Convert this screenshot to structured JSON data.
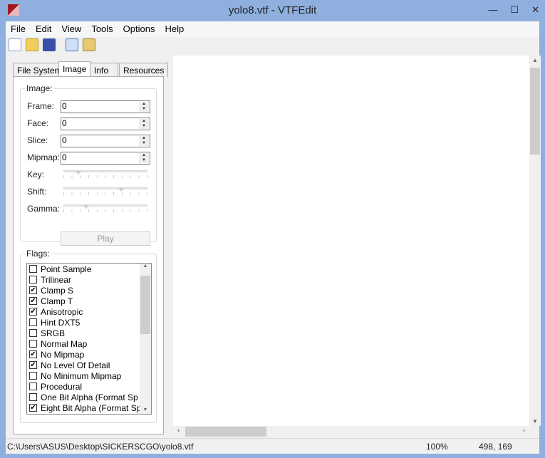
{
  "window": {
    "title": "yolo8.vtf - VTFEdit",
    "minimize": "—",
    "maximize": "☐",
    "close": "✕"
  },
  "menu": [
    "File",
    "Edit",
    "View",
    "Tools",
    "Options",
    "Help"
  ],
  "toolbar": [
    "new-icon",
    "open-icon",
    "save-icon",
    "copy-icon",
    "paste-icon"
  ],
  "tabs": [
    "File System",
    "Image",
    "Info",
    "Resources"
  ],
  "image_group": {
    "title": "Image:",
    "frame_label": "Frame:",
    "frame": "0",
    "face_label": "Face:",
    "face": "0",
    "slice_label": "Slice:",
    "slice": "0",
    "mipmap_label": "Mipmap:",
    "mipmap": "0",
    "key_label": "Key:",
    "key": 0.15,
    "shift_label": "Shift:",
    "shift": 0.7,
    "gamma_label": "Gamma:",
    "gamma": 0.25,
    "play": "Play"
  },
  "flags": {
    "title": "Flags:",
    "items": [
      {
        "label": "Point Sample",
        "checked": false
      },
      {
        "label": "Trilinear",
        "checked": false
      },
      {
        "label": "Clamp S",
        "checked": true
      },
      {
        "label": "Clamp T",
        "checked": true
      },
      {
        "label": "Anisotropic",
        "checked": true
      },
      {
        "label": "Hint DXT5",
        "checked": false
      },
      {
        "label": "SRGB",
        "checked": false
      },
      {
        "label": "Normal Map",
        "checked": false
      },
      {
        "label": "No Mipmap",
        "checked": true
      },
      {
        "label": "No Level Of Detail",
        "checked": true
      },
      {
        "label": "No Minimum Mipmap",
        "checked": false
      },
      {
        "label": "Procedural",
        "checked": false
      },
      {
        "label": "One Bit Alpha (Format Sp",
        "checked": false
      },
      {
        "label": "Eight Bit Alpha (Format Sp",
        "checked": true
      }
    ]
  },
  "status": {
    "path": "C:\\Users\\ASUS\\Desktop\\SICKERSCGO\\yolo8.vtf",
    "zoom": "100%",
    "coords": "498, 169"
  }
}
